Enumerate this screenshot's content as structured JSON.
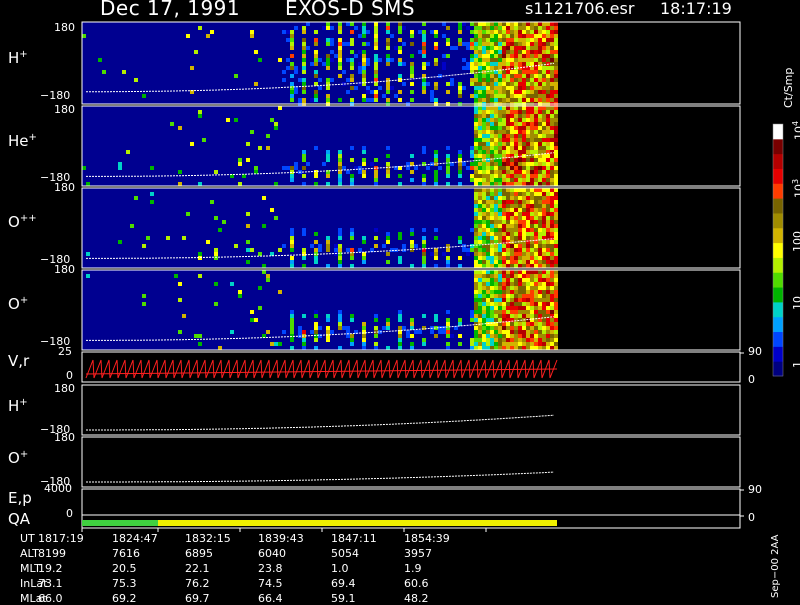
{
  "header": {
    "date": "Dec 17, 1991",
    "instrument": "EXOS-D SMS",
    "file": "s1121706.esr",
    "time": "18:17:19"
  },
  "colorbar": {
    "unit": "Ct/Smp",
    "ticks": [
      "1",
      "10",
      "100",
      "10",
      "10"
    ],
    "exps": [
      "",
      "",
      "",
      "3",
      "4"
    ],
    "colors": [
      "#000080",
      "#0000c8",
      "#0046ff",
      "#00a0ff",
      "#00d2c8",
      "#00b400",
      "#50dc00",
      "#b4f000",
      "#ffff00",
      "#d2b400",
      "#a08c00",
      "#786400",
      "#ff3c00",
      "#e60000",
      "#b40000",
      "#780000",
      "#ffffff"
    ]
  },
  "panels": [
    {
      "id": "hplus",
      "label": "H",
      "sup": "+",
      "ymax": "180",
      "ymin": "−180"
    },
    {
      "id": "heplus",
      "label": "He",
      "sup": "+",
      "ymax": "180",
      "ymin": "−180"
    },
    {
      "id": "oplusplus",
      "label": "O",
      "sup": "++",
      "ymax": "180",
      "ymin": "−180"
    },
    {
      "id": "oplus",
      "label": "O",
      "sup": "+",
      "ymax": "180",
      "ymin": "−180"
    },
    {
      "id": "vr",
      "label": "V,r",
      "sup": "",
      "ymax": "25",
      "ymin": "0",
      "right_top": "90",
      "right_bottom": "0"
    },
    {
      "id": "hplus2",
      "label": "H",
      "sup": "+",
      "ymax": "180",
      "ymin": "−180"
    },
    {
      "id": "oplus2",
      "label": "O",
      "sup": "+",
      "ymax": "180",
      "ymin": "−180"
    },
    {
      "id": "ep",
      "label": "E,p",
      "sup": "",
      "ymax": "4000",
      "ymin": "",
      "right_top": "90",
      "right_bottom": ""
    },
    {
      "id": "qa",
      "label": "QA",
      "sup": "",
      "ymax": "",
      "ymin": "0",
      "right_top": "",
      "right_bottom": "0"
    }
  ],
  "table": {
    "rows": [
      {
        "name": "UT",
        "values": [
          "1817:19",
          "1824:47",
          "1832:15",
          "1839:43",
          "1847:11",
          "1854:39"
        ]
      },
      {
        "name": "ALT",
        "values": [
          "8199",
          "7616",
          "6895",
          "6040",
          "5054",
          "3957"
        ]
      },
      {
        "name": "MLT",
        "values": [
          "19.2",
          "20.5",
          "22.1",
          "23.8",
          "1.0",
          "1.9"
        ]
      },
      {
        "name": "InLat",
        "values": [
          "73.1",
          "75.3",
          "76.2",
          "74.5",
          "69.4",
          "60.6"
        ]
      },
      {
        "name": "MLat",
        "values": [
          "66.0",
          "69.2",
          "69.7",
          "66.4",
          "59.1",
          "48.2"
        ]
      }
    ]
  },
  "footer_note": "Sep−00 2AA",
  "chart_data": {
    "type": "heatmap",
    "title": "Dec 17, 1991   EXOS-D SMS",
    "x_ticks": [
      "1817:19",
      "1824:47",
      "1832:15",
      "1839:43",
      "1847:11",
      "1854:39"
    ],
    "colorbar_unit": "Ct/Smp",
    "colorbar_scale": "log",
    "colorbar_range": [
      1,
      10000
    ],
    "panels": [
      {
        "name": "H+",
        "ylim": [
          -180,
          180
        ]
      },
      {
        "name": "He+",
        "ylim": [
          -180,
          180
        ]
      },
      {
        "name": "O++",
        "ylim": [
          -180,
          180
        ]
      },
      {
        "name": "O+",
        "ylim": [
          -180,
          180
        ]
      },
      {
        "name": "V,r",
        "ylim": [
          0,
          25
        ]
      },
      {
        "name": "H+",
        "ylim": [
          -180,
          180
        ]
      },
      {
        "name": "O+",
        "ylim": [
          -180,
          180
        ]
      },
      {
        "name": "E,p",
        "ylim": [
          0,
          4000
        ]
      },
      {
        "name": "QA"
      }
    ],
    "qa_segments": [
      {
        "from": "1817:19",
        "to": "1824:47",
        "color": "#40d040"
      },
      {
        "from": "1824:47",
        "to": "1858:00",
        "color": "#f0f000"
      }
    ]
  }
}
